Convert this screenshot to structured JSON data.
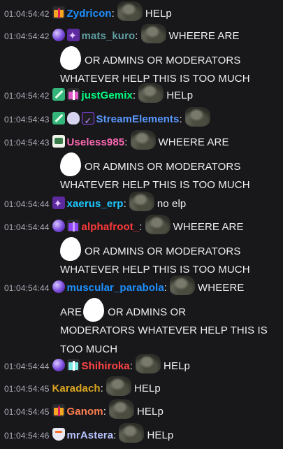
{
  "messages": [
    {
      "timestamp": "01:04:54:42",
      "badges": [
        "gift-badge"
      ],
      "user": "Zydricon",
      "color": "#1e90ff",
      "lines": [
        {
          "pre": "",
          "text": "HELp"
        }
      ]
    },
    {
      "timestamp": "01:04:54:42",
      "badges": [
        "orb-badge",
        "sub-badge"
      ],
      "user": "mats_kuro",
      "color": "#5f9ea0",
      "text1": "WHEERE ARE",
      "text2": "OR ADMINS OR MODERATORS",
      "text3": "WHATEVER HELP THIS IS TOO MUCH"
    },
    {
      "timestamp": "01:04:54:42",
      "badges": [
        "sword-badge",
        "gift-badge"
      ],
      "user": "justGemix",
      "color": "#00ff7f",
      "text": "HELp"
    },
    {
      "timestamp": "01:04:54:43",
      "badges": [
        "sword-badge",
        "wolf-badge",
        "moderator-badge"
      ],
      "user": "StreamElements",
      "color": "#5b99ff"
    },
    {
      "timestamp": "01:04:54:43",
      "badges": [
        "turbo-badge"
      ],
      "user": "Useless985",
      "color": "#ff69b4",
      "text1": "WHEERE ARE",
      "text2": "OR ADMINS OR MODERATORS",
      "text3": "WHATEVER HELP THIS IS TOO MUCH"
    },
    {
      "timestamp": "01:04:54:44",
      "badges": [
        "sub-badge"
      ],
      "user": "xaerus_erp",
      "color": "#1ec8ff",
      "text": "no elp"
    },
    {
      "timestamp": "01:04:54:44",
      "badges": [
        "orb-badge",
        "gift-badge"
      ],
      "user": "alphafroot_",
      "color": "#ff3a3a",
      "text1": "WHEERE ARE",
      "text2": "OR ADMINS OR MODERATORS",
      "text3": "WHATEVER HELP THIS IS TOO MUCH"
    },
    {
      "timestamp": "01:04:54:44",
      "badges": [
        "orb-badge"
      ],
      "user": "muscular_parabola",
      "color": "#1e90ff",
      "text1": "WHEERE",
      "text2a": "ARE",
      "text2b": "OR ADMINS OR",
      "text3": "MODERATORS WHATEVER HELP THIS IS",
      "text4": "TOO MUCH"
    },
    {
      "timestamp": "01:04:54:44",
      "badges": [
        "orb-badge",
        "gift-badge"
      ],
      "user": "Shihiroka",
      "color": "#ff4545",
      "text": "HELp"
    },
    {
      "timestamp": "01:04:54:45",
      "badges": [],
      "user": "Karadach",
      "color": "#daa520",
      "text": "HELp"
    },
    {
      "timestamp": "01:04:54:45",
      "badges": [
        "gift-badge"
      ],
      "user": "Ganom",
      "color": "#ff7f50",
      "text": "HELp"
    },
    {
      "timestamp": "01:04:54:46",
      "badges": [
        "shield-badge"
      ],
      "user": "mrAstera",
      "color": "#b8c4ff",
      "text": "HELp"
    }
  ]
}
